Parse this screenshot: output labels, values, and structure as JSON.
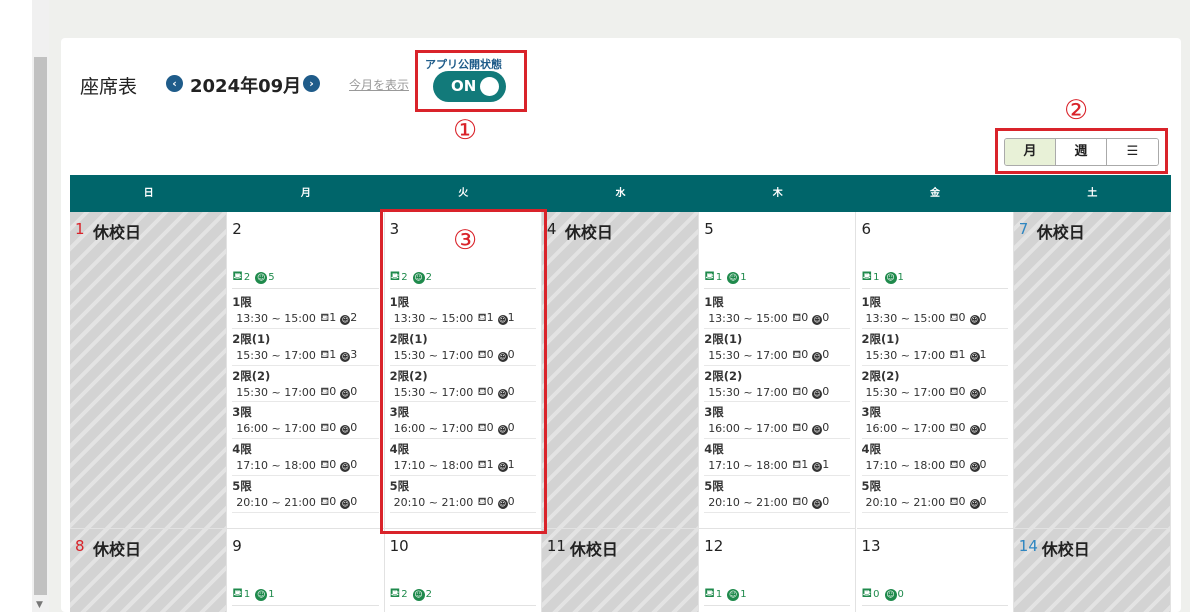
{
  "page": {
    "title": "座席表",
    "month": "2024年09月",
    "this_month_link": "今月を表示",
    "prev_icon": "chevron-left-icon",
    "next_icon": "chevron-right-icon",
    "toggle_label": "アプリ公開状態",
    "toggle_state": "ON"
  },
  "annotations": [
    "①",
    "②",
    "③"
  ],
  "view_buttons": [
    {
      "label": "月",
      "active": true
    },
    {
      "label": "週",
      "active": false
    },
    {
      "label": "☰",
      "icon": "list-icon",
      "active": false
    }
  ],
  "weekdays": [
    "日",
    "月",
    "火",
    "水",
    "木",
    "金",
    "土"
  ],
  "weeks": [
    [
      {
        "day": "1",
        "holiday": "休校日",
        "kind": "sun"
      },
      {
        "day": "2",
        "seats": "2",
        "students": "5",
        "periods": [
          {
            "name": "1限",
            "time": "13:30 ~ 15:00",
            "seats": "1",
            "students": "2"
          },
          {
            "name": "2限(1)",
            "time": "15:30 ~ 17:00",
            "seats": "1",
            "students": "3"
          },
          {
            "name": "2限(2)",
            "time": "15:30 ~ 17:00",
            "seats": "0",
            "students": "0"
          },
          {
            "name": "3限",
            "time": "16:00 ~ 17:00",
            "seats": "0",
            "students": "0"
          },
          {
            "name": "4限",
            "time": "17:10 ~ 18:00",
            "seats": "0",
            "students": "0"
          },
          {
            "name": "5限",
            "time": "20:10 ~ 21:00",
            "seats": "0",
            "students": "0"
          }
        ]
      },
      {
        "day": "3",
        "seats": "2",
        "students": "2",
        "periods": [
          {
            "name": "1限",
            "time": "13:30 ~ 15:00",
            "seats": "1",
            "students": "1"
          },
          {
            "name": "2限(1)",
            "time": "15:30 ~ 17:00",
            "seats": "0",
            "students": "0"
          },
          {
            "name": "2限(2)",
            "time": "15:30 ~ 17:00",
            "seats": "0",
            "students": "0"
          },
          {
            "name": "3限",
            "time": "16:00 ~ 17:00",
            "seats": "0",
            "students": "0"
          },
          {
            "name": "4限",
            "time": "17:10 ~ 18:00",
            "seats": "1",
            "students": "1"
          },
          {
            "name": "5限",
            "time": "20:10 ~ 21:00",
            "seats": "0",
            "students": "0"
          }
        ]
      },
      {
        "day": "4",
        "holiday": "休校日",
        "kind": "weekday"
      },
      {
        "day": "5",
        "seats": "1",
        "students": "1",
        "periods": [
          {
            "name": "1限",
            "time": "13:30 ~ 15:00",
            "seats": "0",
            "students": "0"
          },
          {
            "name": "2限(1)",
            "time": "15:30 ~ 17:00",
            "seats": "0",
            "students": "0"
          },
          {
            "name": "2限(2)",
            "time": "15:30 ~ 17:00",
            "seats": "0",
            "students": "0"
          },
          {
            "name": "3限",
            "time": "16:00 ~ 17:00",
            "seats": "0",
            "students": "0"
          },
          {
            "name": "4限",
            "time": "17:10 ~ 18:00",
            "seats": "1",
            "students": "1"
          },
          {
            "name": "5限",
            "time": "20:10 ~ 21:00",
            "seats": "0",
            "students": "0"
          }
        ]
      },
      {
        "day": "6",
        "seats": "1",
        "students": "1",
        "periods": [
          {
            "name": "1限",
            "time": "13:30 ~ 15:00",
            "seats": "0",
            "students": "0"
          },
          {
            "name": "2限(1)",
            "time": "15:30 ~ 17:00",
            "seats": "1",
            "students": "1"
          },
          {
            "name": "2限(2)",
            "time": "15:30 ~ 17:00",
            "seats": "0",
            "students": "0"
          },
          {
            "name": "3限",
            "time": "16:00 ~ 17:00",
            "seats": "0",
            "students": "0"
          },
          {
            "name": "4限",
            "time": "17:10 ~ 18:00",
            "seats": "0",
            "students": "0"
          },
          {
            "name": "5限",
            "time": "20:10 ~ 21:00",
            "seats": "0",
            "students": "0"
          }
        ]
      },
      {
        "day": "7",
        "holiday": "休校日",
        "kind": "sat"
      }
    ],
    [
      {
        "day": "8",
        "holiday": "休校日",
        "kind": "sun"
      },
      {
        "day": "9",
        "seats": "1",
        "students": "1"
      },
      {
        "day": "10",
        "seats": "2",
        "students": "2"
      },
      {
        "day": "11",
        "holiday": "休校日",
        "kind": "weekday"
      },
      {
        "day": "12",
        "seats": "1",
        "students": "1"
      },
      {
        "day": "13",
        "seats": "0",
        "students": "0"
      },
      {
        "day": "14",
        "holiday": "休校日",
        "kind": "sat"
      }
    ]
  ],
  "colors": {
    "header_bg": "#00656a",
    "toggle_bg": "#127a7a",
    "accent_green": "#1f8a4c",
    "annotation_red": "#d9232a",
    "nav_blue": "#1f5c8a"
  }
}
